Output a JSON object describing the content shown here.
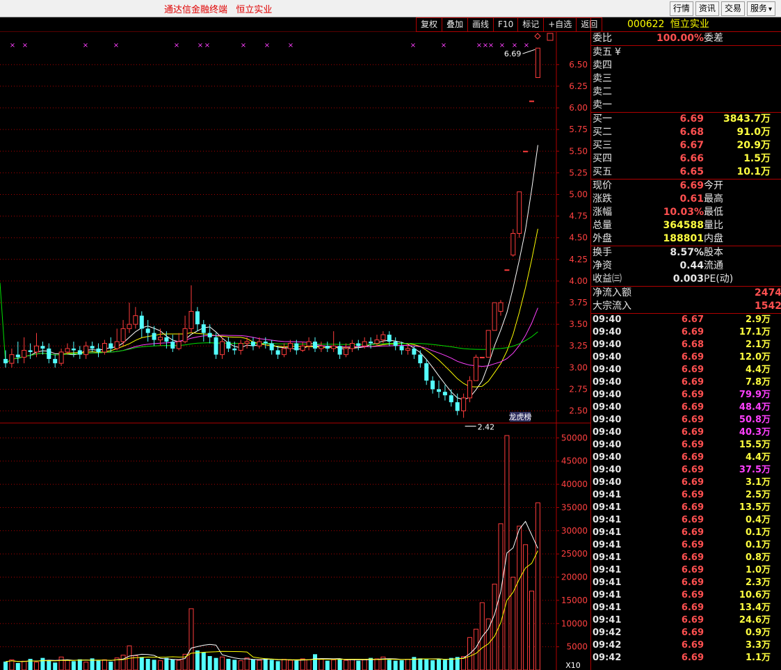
{
  "app_title": "通达信金融终端   恒立实业",
  "top_menu": [
    "行情",
    "资讯",
    "交易",
    "服务"
  ],
  "chart_toolbar": [
    "复权",
    "叠加",
    "画线",
    "F10",
    "标记",
    "+自选",
    "返回"
  ],
  "stock": {
    "code": "000622",
    "name": "恒立实业"
  },
  "weibi": {
    "label": "委比",
    "value": "100.00%",
    "label2": "委差"
  },
  "sell_levels": [
    {
      "label": "卖五",
      "mark": "¥"
    },
    {
      "label": "卖四"
    },
    {
      "label": "卖三"
    },
    {
      "label": "卖二"
    },
    {
      "label": "卖一"
    }
  ],
  "buy_levels": [
    {
      "label": "买一",
      "price": "6.69",
      "volume": "3843.7万"
    },
    {
      "label": "买二",
      "price": "6.68",
      "volume": "91.0万"
    },
    {
      "label": "买三",
      "price": "6.67",
      "volume": "20.9万"
    },
    {
      "label": "买四",
      "price": "6.66",
      "volume": "1.5万"
    },
    {
      "label": "买五",
      "price": "6.65",
      "volume": "10.1万"
    }
  ],
  "quote": [
    {
      "label": "现价",
      "value": "6.69",
      "label2": "今开"
    },
    {
      "label": "涨跌",
      "value": "0.61",
      "label2": "最高"
    },
    {
      "label": "涨幅",
      "value": "10.03%",
      "label2": "最低"
    },
    {
      "label": "总量",
      "value": "364588",
      "label2": "量比"
    },
    {
      "label": "外盘",
      "value": "188801",
      "label2": "内盘"
    }
  ],
  "stats": [
    {
      "label": "换手",
      "value": "8.57%",
      "label2": "股本"
    },
    {
      "label": "净资",
      "value": "0.44",
      "label2": "流通"
    },
    {
      "label": "收益㈢",
      "value": "0.003",
      "label2": "PE(动)"
    }
  ],
  "flow": [
    {
      "label": "净流入额",
      "value": "2474"
    },
    {
      "label": "大宗流入",
      "value": "1542"
    }
  ],
  "ticks": [
    {
      "time": "09:40",
      "price": "6.67",
      "vol": "2.9万",
      "c": "yellow"
    },
    {
      "time": "09:40",
      "price": "6.69",
      "vol": "17.1万",
      "c": "yellow"
    },
    {
      "time": "09:40",
      "price": "6.68",
      "vol": "2.1万",
      "c": "yellow"
    },
    {
      "time": "09:40",
      "price": "6.69",
      "vol": "12.0万",
      "c": "yellow"
    },
    {
      "time": "09:40",
      "price": "6.69",
      "vol": "4.4万",
      "c": "yellow"
    },
    {
      "time": "09:40",
      "price": "6.69",
      "vol": "7.8万",
      "c": "yellow"
    },
    {
      "time": "09:40",
      "price": "6.69",
      "vol": "79.9万",
      "c": "magenta"
    },
    {
      "time": "09:40",
      "price": "6.69",
      "vol": "48.4万",
      "c": "magenta"
    },
    {
      "time": "09:40",
      "price": "6.69",
      "vol": "50.8万",
      "c": "magenta"
    },
    {
      "time": "09:40",
      "price": "6.69",
      "vol": "40.3万",
      "c": "magenta"
    },
    {
      "time": "09:40",
      "price": "6.69",
      "vol": "15.5万",
      "c": "yellow"
    },
    {
      "time": "09:40",
      "price": "6.69",
      "vol": "4.4万",
      "c": "yellow"
    },
    {
      "time": "09:40",
      "price": "6.69",
      "vol": "37.5万",
      "c": "magenta"
    },
    {
      "time": "09:40",
      "price": "6.69",
      "vol": "3.1万",
      "c": "yellow"
    },
    {
      "time": "09:41",
      "price": "6.69",
      "vol": "2.5万",
      "c": "yellow"
    },
    {
      "time": "09:41",
      "price": "6.69",
      "vol": "13.5万",
      "c": "yellow"
    },
    {
      "time": "09:41",
      "price": "6.69",
      "vol": "0.4万",
      "c": "yellow"
    },
    {
      "time": "09:41",
      "price": "6.69",
      "vol": "0.1万",
      "c": "yellow"
    },
    {
      "time": "09:41",
      "price": "6.69",
      "vol": "0.1万",
      "c": "yellow"
    },
    {
      "time": "09:41",
      "price": "6.69",
      "vol": "0.8万",
      "c": "yellow"
    },
    {
      "time": "09:41",
      "price": "6.69",
      "vol": "1.0万",
      "c": "yellow"
    },
    {
      "time": "09:41",
      "price": "6.69",
      "vol": "2.3万",
      "c": "yellow"
    },
    {
      "time": "09:41",
      "price": "6.69",
      "vol": "10.6万",
      "c": "yellow"
    },
    {
      "time": "09:41",
      "price": "6.69",
      "vol": "13.4万",
      "c": "yellow"
    },
    {
      "time": "09:41",
      "price": "6.69",
      "vol": "24.6万",
      "c": "yellow"
    },
    {
      "time": "09:42",
      "price": "6.69",
      "vol": "0.9万",
      "c": "yellow"
    },
    {
      "time": "09:42",
      "price": "6.69",
      "vol": "3.3万",
      "c": "yellow"
    },
    {
      "time": "09:42",
      "price": "6.69",
      "vol": "1.1万",
      "c": "yellow"
    }
  ],
  "colors": {
    "up": "#ff3c3c",
    "down": "#54ffff",
    "grid": "#b00000",
    "axis_text": "#ff4040"
  },
  "chart_data": [
    {
      "type": "candlestick",
      "title": "",
      "y_ticks": [
        2.5,
        2.75,
        3.0,
        3.25,
        3.5,
        3.75,
        4.0,
        4.25,
        4.5,
        4.75,
        5.0,
        5.25,
        5.5,
        5.75,
        6.0,
        6.25,
        6.5
      ],
      "ylim": [
        2.36,
        6.82
      ],
      "annotations": [
        {
          "text": "6.69",
          "at": "high"
        },
        {
          "text": "2.42",
          "at": "low"
        }
      ],
      "badge": "龙虎榜",
      "candles": [
        [
          3.1,
          3.05,
          3.2,
          3.0
        ],
        [
          3.05,
          3.15,
          3.22,
          3.0
        ],
        [
          3.15,
          3.12,
          3.3,
          3.05
        ],
        [
          3.12,
          3.2,
          3.35,
          3.05
        ],
        [
          3.2,
          3.18,
          3.28,
          3.1
        ],
        [
          3.18,
          3.25,
          3.4,
          3.12
        ],
        [
          3.25,
          3.22,
          3.3,
          3.15
        ],
        [
          3.22,
          3.1,
          3.28,
          3.05
        ],
        [
          3.1,
          3.05,
          3.15,
          3.0
        ],
        [
          3.05,
          3.18,
          3.22,
          3.02
        ],
        [
          3.18,
          3.22,
          3.28,
          3.15
        ],
        [
          3.22,
          3.2,
          3.3,
          3.12
        ],
        [
          3.2,
          3.15,
          3.25,
          3.1
        ],
        [
          3.15,
          3.25,
          3.3,
          3.1
        ],
        [
          3.25,
          3.22,
          3.3,
          3.18
        ],
        [
          3.22,
          3.18,
          3.28,
          3.12
        ],
        [
          3.18,
          3.28,
          3.32,
          3.15
        ],
        [
          3.28,
          3.22,
          3.35,
          3.18
        ],
        [
          3.22,
          3.3,
          3.45,
          3.2
        ],
        [
          3.3,
          3.45,
          3.55,
          3.25
        ],
        [
          3.45,
          3.5,
          3.75,
          3.4
        ],
        [
          3.5,
          3.6,
          3.7,
          3.45
        ],
        [
          3.6,
          3.45,
          3.65,
          3.35
        ],
        [
          3.45,
          3.4,
          3.55,
          3.3
        ],
        [
          3.4,
          3.32,
          3.48,
          3.25
        ],
        [
          3.32,
          3.35,
          3.45,
          3.25
        ],
        [
          3.35,
          3.3,
          3.42,
          3.22
        ],
        [
          3.3,
          3.22,
          3.38,
          3.18
        ],
        [
          3.22,
          3.3,
          3.4,
          3.2
        ],
        [
          3.3,
          3.45,
          3.6,
          3.28
        ],
        [
          3.45,
          3.65,
          3.95,
          3.4
        ],
        [
          3.65,
          3.5,
          3.7,
          3.42
        ],
        [
          3.5,
          3.4,
          3.55,
          3.3
        ],
        [
          3.4,
          3.35,
          3.5,
          3.28
        ],
        [
          3.35,
          3.15,
          3.4,
          3.1
        ],
        [
          3.15,
          3.3,
          3.35,
          3.1
        ],
        [
          3.3,
          3.22,
          3.35,
          3.18
        ],
        [
          3.22,
          3.2,
          3.3,
          3.15
        ],
        [
          3.2,
          3.28,
          3.32,
          3.15
        ],
        [
          3.28,
          3.3,
          3.35,
          3.22
        ],
        [
          3.3,
          3.25,
          3.35,
          3.2
        ],
        [
          3.25,
          3.3,
          3.35,
          3.22
        ],
        [
          3.3,
          3.28,
          3.35,
          3.22
        ],
        [
          3.28,
          3.2,
          3.32,
          3.15
        ],
        [
          3.2,
          3.15,
          3.25,
          3.1
        ],
        [
          3.15,
          3.22,
          3.28,
          3.12
        ],
        [
          3.22,
          3.28,
          3.32,
          3.18
        ],
        [
          3.28,
          3.2,
          3.32,
          3.15
        ],
        [
          3.2,
          3.25,
          3.3,
          3.18
        ],
        [
          3.25,
          3.3,
          3.35,
          3.2
        ],
        [
          3.3,
          3.22,
          3.35,
          3.18
        ],
        [
          3.22,
          3.25,
          3.3,
          3.18
        ],
        [
          3.25,
          3.22,
          3.3,
          3.18
        ],
        [
          3.22,
          3.25,
          3.42,
          3.18
        ],
        [
          3.25,
          3.15,
          3.3,
          3.1
        ],
        [
          3.15,
          3.22,
          3.28,
          3.12
        ],
        [
          3.22,
          3.28,
          3.32,
          3.18
        ],
        [
          3.28,
          3.25,
          3.32,
          3.2
        ],
        [
          3.25,
          3.3,
          3.35,
          3.22
        ],
        [
          3.3,
          3.28,
          3.35,
          3.22
        ],
        [
          3.28,
          3.32,
          3.38,
          3.25
        ],
        [
          3.32,
          3.38,
          3.42,
          3.28
        ],
        [
          3.38,
          3.3,
          3.42,
          3.25
        ],
        [
          3.3,
          3.25,
          3.35,
          3.2
        ],
        [
          3.25,
          3.2,
          3.3,
          3.15
        ],
        [
          3.2,
          3.22,
          3.28,
          3.15
        ],
        [
          3.22,
          3.15,
          3.25,
          3.1
        ],
        [
          3.15,
          3.05,
          3.2,
          3.0
        ],
        [
          3.05,
          2.85,
          3.1,
          2.8
        ],
        [
          2.85,
          2.75,
          2.9,
          2.7
        ],
        [
          2.75,
          2.72,
          2.85,
          2.65
        ],
        [
          2.72,
          2.68,
          2.8,
          2.62
        ],
        [
          2.68,
          2.6,
          2.75,
          2.55
        ],
        [
          2.6,
          2.5,
          2.7,
          2.45
        ],
        [
          2.5,
          2.65,
          2.7,
          2.42
        ],
        [
          2.65,
          2.85,
          2.9,
          2.6
        ],
        [
          2.85,
          3.12,
          3.15,
          2.85
        ],
        [
          3.12,
          3.12,
          3.12,
          3.12
        ],
        [
          3.12,
          3.43,
          3.43,
          3.12
        ],
        [
          3.43,
          3.75,
          3.75,
          3.65
        ],
        [
          3.65,
          3.75,
          3.78,
          3.6
        ],
        [
          4.13,
          4.13,
          4.13,
          4.13
        ],
        [
          4.3,
          4.55,
          4.6,
          4.28
        ],
        [
          4.55,
          5.03,
          5.03,
          4.5
        ],
        [
          5.5,
          5.5,
          5.5,
          5.5
        ],
        [
          6.08,
          6.08,
          6.08,
          6.08
        ],
        [
          6.35,
          6.69,
          6.69,
          6.35
        ]
      ]
    },
    {
      "type": "bar",
      "title": "",
      "y_ticks": [
        5000,
        10000,
        15000,
        20000,
        25000,
        30000,
        35000,
        40000,
        45000,
        50000
      ],
      "unit": "X10",
      "values": [
        1800,
        2200,
        1500,
        1900,
        2400,
        1700,
        2600,
        2000,
        1600,
        2800,
        2100,
        1900,
        2300,
        1700,
        2500,
        2000,
        2200,
        1800,
        2600,
        3200,
        5200,
        3100,
        2800,
        2400,
        2200,
        2000,
        2600,
        2300,
        2100,
        3400,
        13200,
        4200,
        3800,
        3000,
        2600,
        2800,
        2400,
        2200,
        2000,
        2600,
        2300,
        2100,
        2500,
        2200,
        1900,
        2300,
        2100,
        2000,
        2400,
        2200,
        3400,
        2300,
        2000,
        2200,
        2400,
        2100,
        2300,
        2000,
        2200,
        2600,
        2400,
        2800,
        2200,
        2000,
        2100,
        2300,
        2800,
        2500,
        2300,
        2100,
        2400,
        2200,
        2600,
        2800,
        2900,
        7000,
        8800,
        14500,
        11000,
        18500,
        31500,
        50500,
        20000,
        31000,
        27000,
        17000,
        36000
      ]
    }
  ]
}
